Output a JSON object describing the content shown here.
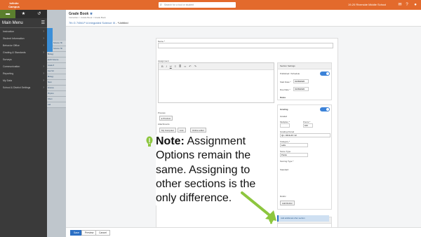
{
  "topbar": {
    "logo": "Infinite Campus",
    "search_placeholder": "Search for a tool or student",
    "school": "19-20 Riverside Middle School"
  },
  "sidebar": {
    "menu_title": "Main Menu",
    "items": [
      "Instruction",
      "Student Information",
      "Behavior Office",
      "Grading & Standards",
      "Surveys",
      "Communication",
      "Reporting",
      "My Data",
      "School & District Settings"
    ]
  },
  "panel2": {
    "items": [
      "Science 7th",
      "Science 7th",
      "Biology",
      "Earth Science",
      "Grade 8",
      "Geo Sci",
      "Biology",
      "Stem",
      "Science",
      "Physics",
      "Chem",
      "Lab"
    ]
  },
  "header": {
    "title": "Grade Book",
    "breadcrumb": "Instruction > Grade Book > Grade Book",
    "section": "7th G 7/6M-P A Integrated Science III",
    "section_suffix": " - *Untitled"
  },
  "form": {
    "name_label": "Name *",
    "assignment_label": "Assignment",
    "student_preview_label": "Preview",
    "attachments_label": "Attachments",
    "attach_buttons": [
      "My Computer",
      "Link",
      "Online editor"
    ],
    "dates_header": "Section Settings",
    "assigned_toggle_label": "Published / Schedule",
    "start_date_label": "Start Date *",
    "start_date_value": "01/09/2020",
    "due_date_label": "Due Date *",
    "due_date_value": "01/09/2020",
    "dates_label": "Dates",
    "grading_label": "Grading",
    "grading_toggle_label": "Graded",
    "multiplier_label": "Multiplier *",
    "points_label": "Points *",
    "points_value": "100",
    "grading_period_label": "Grading Period",
    "grading_period_value": "Q1 / 2019-20 / 22",
    "category_label": "Category *",
    "category_value": "Labs",
    "scoring_label": "Score Type",
    "scoring_value": "Points",
    "standard_label": "Standard",
    "scoring_type_label": "Scoring Type *",
    "rubric_label": "Rubric",
    "add_rubric": "Add Rubric",
    "section_settings_label": "Other Sections",
    "add_section_label": "Add additional other section"
  },
  "note": {
    "title": "Note:",
    "body": " Assignment Options remain the same.  Assigning to other sections is the only difference."
  },
  "footer": {
    "save": "Save",
    "preview": "Preview",
    "cancel": "Cancel"
  },
  "colors": {
    "accent_orange": "#e36a2c",
    "green": "#8dc63f",
    "blue": "#2b6fc4"
  }
}
